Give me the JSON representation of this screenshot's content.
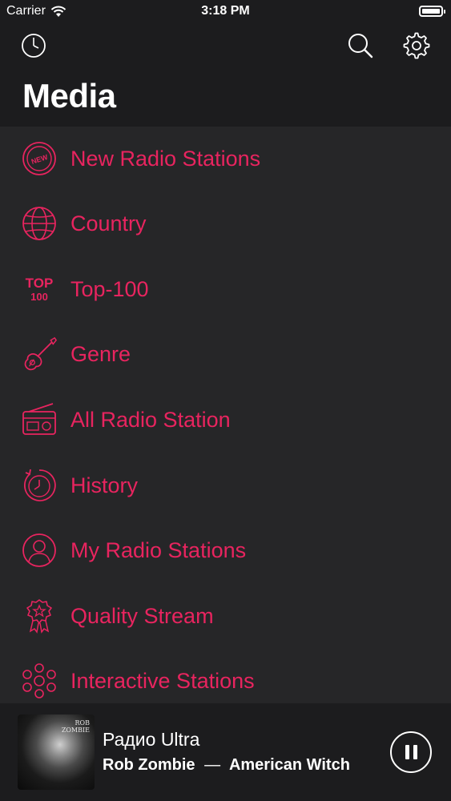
{
  "status_bar": {
    "carrier": "Carrier",
    "time": "3:18 PM",
    "battery_level": 1.0
  },
  "header": {
    "title": "Media",
    "left_icon": "clock-icon",
    "right_icons": [
      "search-icon",
      "gear-icon"
    ]
  },
  "colors": {
    "accent": "#e8245f",
    "background": "#1c1c1e",
    "list_background": "#262628",
    "text": "#ffffff"
  },
  "menu": {
    "items": [
      {
        "label": "New Radio Stations",
        "icon": "new-badge-icon"
      },
      {
        "label": "Country",
        "icon": "globe-icon"
      },
      {
        "label": "Top-100",
        "icon": "top-100-icon",
        "icon_text_top": "TOP",
        "icon_text_bottom": "100"
      },
      {
        "label": "Genre",
        "icon": "guitar-icon"
      },
      {
        "label": "All Radio Station",
        "icon": "radio-icon"
      },
      {
        "label": "History",
        "icon": "history-icon"
      },
      {
        "label": "My Radio Stations",
        "icon": "user-icon"
      },
      {
        "label": "Quality Stream",
        "icon": "award-icon"
      },
      {
        "label": "Interactive Stations",
        "icon": "molecule-icon"
      }
    ]
  },
  "player": {
    "station": "Радио Ultra",
    "artist": "Rob Zombie",
    "separator": "—",
    "track": "American Witch",
    "album_art_text": [
      "ROB",
      "ZOMBIE"
    ]
  }
}
